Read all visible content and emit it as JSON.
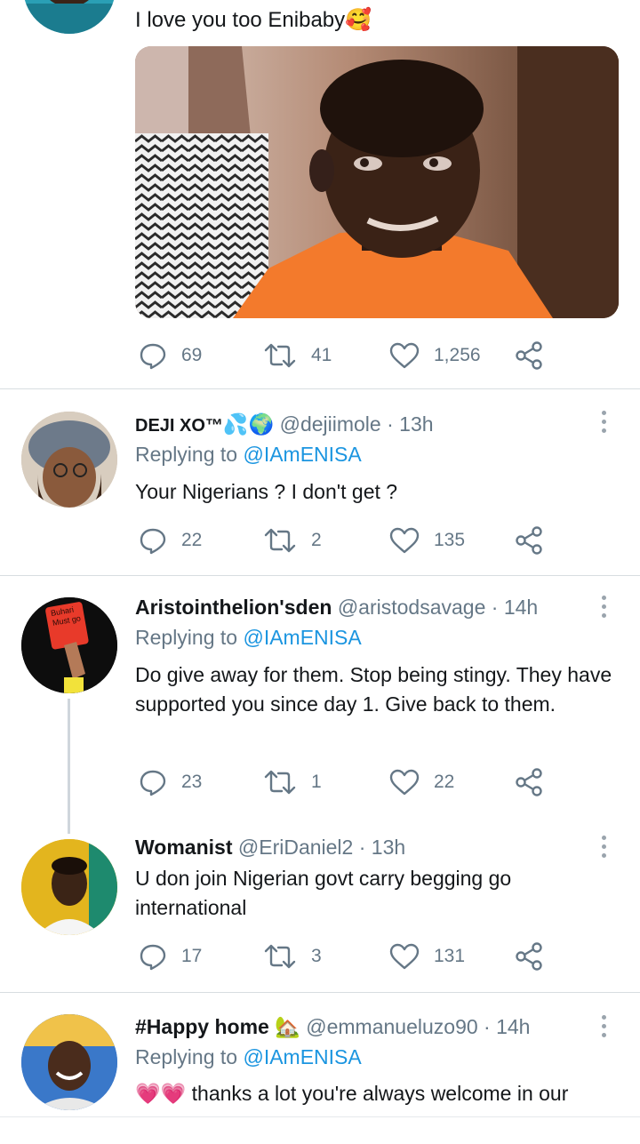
{
  "tweets": [
    {
      "text": "I love you too Enibaby",
      "emoji": "🥰",
      "has_media": true,
      "replies": "69",
      "retweets": "41",
      "likes": "1,256"
    },
    {
      "name": "DEJI XO™",
      "name_emoji": "💦🌍",
      "handle": "@dejiimole",
      "time": "· 13h",
      "replying_label": "Replying to",
      "replying_to": "@IAmENISA",
      "text": "Your Nigerians ? I don't get ?",
      "replies": "22",
      "retweets": "2",
      "likes": "135"
    },
    {
      "name": "Aristointhelion'sden",
      "handle": "@aristodsavage",
      "time": "· 14h",
      "replying_label": "Replying to",
      "replying_to": "@IAmENISA",
      "text": "Do give away for them. Stop being stingy. They have supported you since day 1. Give back to them.",
      "avatar_sign_text": "Buhari Must go",
      "replies": "23",
      "retweets": "1",
      "likes": "22"
    },
    {
      "name": "Womanist",
      "handle": "@EriDaniel2",
      "time": "· 13h",
      "text": "U don join Nigerian govt carry begging go international",
      "replies": "17",
      "retweets": "3",
      "likes": "131"
    },
    {
      "name": "#Happy home",
      "name_emoji": "🏡",
      "handle": "@emmanueluzo90",
      "time": "· 14h",
      "replying_label": "Replying to",
      "replying_to": "@IAmENISA",
      "text_emoji": "💗💗",
      "text": "thanks a lot you're always welcome in our"
    }
  ],
  "icons": {
    "reply": "reply-icon",
    "retweet": "retweet-icon",
    "like": "heart-icon",
    "share": "share-icon",
    "more": "more-options-icon"
  },
  "colors": {
    "link": "#1b95e0",
    "muted": "#657786",
    "text": "#14171a",
    "divider": "#d8dde1"
  }
}
